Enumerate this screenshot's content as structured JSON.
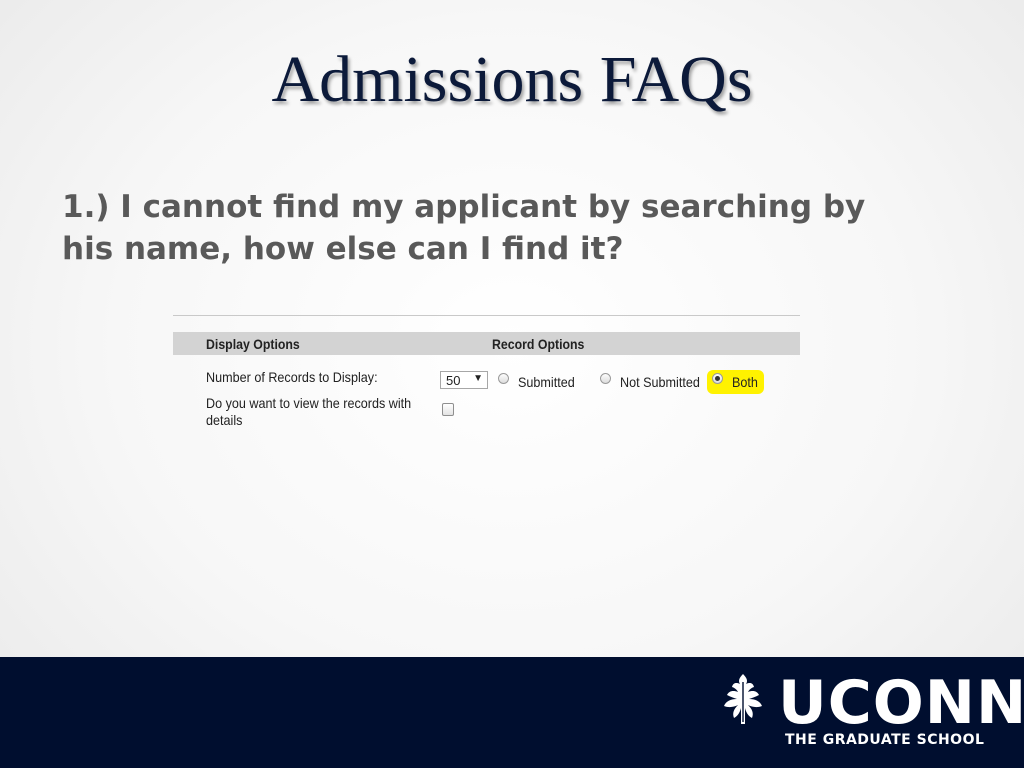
{
  "title": "Admissions FAQs",
  "question": "1.) I cannot find my applicant by searching by his name, how else can I find it?",
  "screenshot": {
    "display_options_header": "Display Options",
    "record_options_header": "Record Options",
    "records_to_display_label": "Number of Records to Display:",
    "records_select_value": "50",
    "details_label_line1": "Do you want to view the records with",
    "details_label_line2": "details",
    "radio_options": [
      {
        "label": "Submitted",
        "checked": false
      },
      {
        "label": "Not Submitted",
        "checked": false
      },
      {
        "label": "Both",
        "checked": true
      }
    ],
    "highlight_color": "#fff200"
  },
  "footer": {
    "logo_text": "UCONN",
    "logo_subtitle": "THE GRADUATE SCHOOL",
    "background_color": "#000e2f",
    "logo_icon": "oak-leaf-icon"
  }
}
